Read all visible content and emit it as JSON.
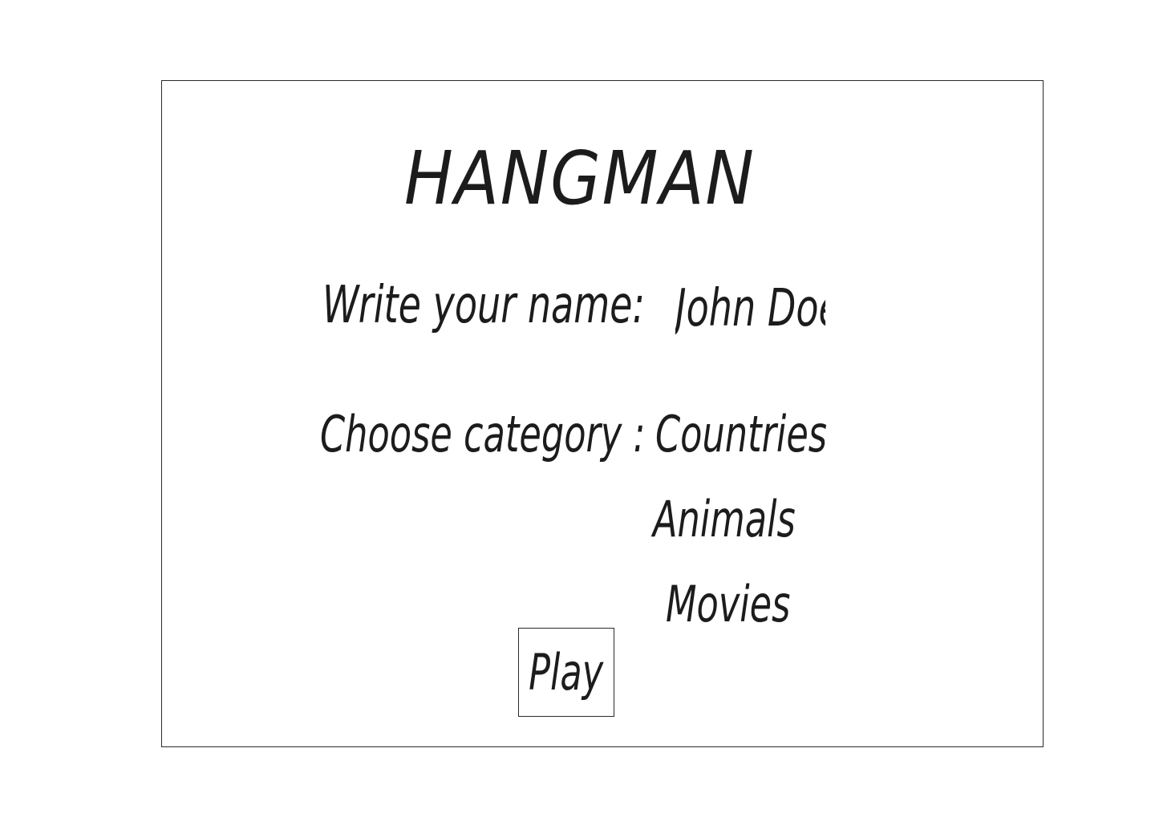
{
  "game": {
    "title": "HANGMAN"
  },
  "name_field": {
    "label": "Write your name:",
    "value": "John Doe"
  },
  "category": {
    "label": "Choose category :",
    "options": [
      "Countries",
      "Animals",
      "Movies"
    ]
  },
  "actions": {
    "play_label": "Play"
  },
  "colors": {
    "ink": "#1c1c1c",
    "border": "#2a2a2a",
    "background": "#ffffff"
  }
}
